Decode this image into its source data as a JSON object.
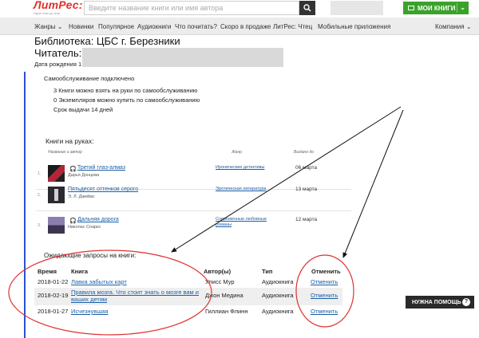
{
  "header": {
    "logo": "ЛитРес:",
    "logo_tagline": "Один клик до книг",
    "search_placeholder": "Введите название книги или имя автора",
    "my_books_label": "МОИ КНИГИ"
  },
  "nav": {
    "items": [
      "Жанры ⌄",
      "Новинки",
      "Популярное",
      "Аудиокниги",
      "Что почитать?",
      "Скоро в продаже",
      "ЛитРес: Чтец",
      "Мобильные приложения"
    ],
    "company": "Компания ⌄"
  },
  "library": {
    "title": "Библиотека: ЦБС г. Березники",
    "reader_label": "Читатель:",
    "dob_label": "Дата рождения 1",
    "self_service": "Самообслуживание подключено",
    "info": [
      "3 Книги можно взять на руки по самообслуживанию",
      "0 Экземпляров можно купить по самообслуживанию",
      "Срок выдачи 14 дней"
    ]
  },
  "on_hand": {
    "title": "Книги на руках:",
    "headers": {
      "name": "Название и автор",
      "genre": "Жанр",
      "issued": "Выдано до"
    },
    "rows": [
      {
        "num": "1.",
        "title": "Третий глаз-алмаз",
        "author": "Дарья Донцова",
        "genre": "Иронические детективы",
        "date": "06 марта",
        "audio": true,
        "cover_color": "#b0273a"
      },
      {
        "num": "2.",
        "title": "Пятьдесят оттенков серого",
        "author": "Э. Л. Джеймс",
        "genre": "Эротическая литература",
        "date": "13 марта",
        "audio": false,
        "cover_color": "#3a3a44"
      },
      {
        "num": "3.",
        "title": "Дальняя дорога",
        "author": "Николас Спаркс",
        "genre": "Современные любовные романы",
        "date": "12 марта",
        "audio": true,
        "cover_color": "#6a5a8a"
      }
    ]
  },
  "pending": {
    "title": "Ожидающие запросы на книги:",
    "headers": {
      "time": "Время",
      "book": "Книга",
      "author": "Автор(ы)",
      "type": "Тип",
      "cancel": "Отменить"
    },
    "rows": [
      {
        "time": "2018-01-22",
        "book": "Лавка забытых карт",
        "book2": "",
        "author": "Улисс Мур",
        "type": "Аудиокнига",
        "cancel": "Отменить"
      },
      {
        "time": "2018-02-19",
        "book": "Правила мозга. Что стоит знать о мозге вам и",
        "book2": "ваших детям",
        "author": "Джон Медина",
        "type": "Аудиокнига",
        "cancel": "Отменить"
      },
      {
        "time": "2018-01-27",
        "book": "Исчезнувшая",
        "book2": "",
        "author": "Гиллиан Флинн",
        "type": "Аудиокнига",
        "cancel": "Отменить"
      }
    ]
  },
  "help_button": "НУЖНА ПОМОЩЬ",
  "colors": {
    "annotation_red": "#e03030",
    "link": "#1b5fa6",
    "green": "#3aa22a"
  }
}
